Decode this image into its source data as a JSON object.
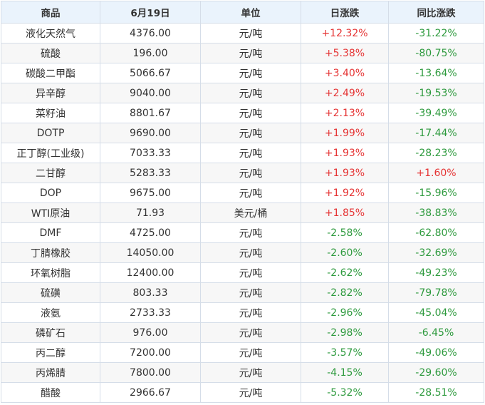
{
  "colors": {
    "up": "#e53333",
    "down": "#2e9a3e",
    "header_bg": "#eaf3fc",
    "border": "#d5dde8"
  },
  "headers": [
    "商品",
    "6月19日",
    "单位",
    "日涨跌",
    "同比涨跌"
  ],
  "rows": [
    [
      "液化天然气",
      "4376.00",
      "元/吨",
      "+12.32%",
      "-31.22%"
    ],
    [
      "硫酸",
      "196.00",
      "元/吨",
      "+5.38%",
      "-80.75%"
    ],
    [
      "碳酸二甲酯",
      "5066.67",
      "元/吨",
      "+3.40%",
      "-13.64%"
    ],
    [
      "异辛醇",
      "9040.00",
      "元/吨",
      "+2.49%",
      "-19.53%"
    ],
    [
      "菜籽油",
      "8801.67",
      "元/吨",
      "+2.13%",
      "-39.49%"
    ],
    [
      "DOTP",
      "9690.00",
      "元/吨",
      "+1.99%",
      "-17.44%"
    ],
    [
      "正丁醇(工业级)",
      "7033.33",
      "元/吨",
      "+1.93%",
      "-28.23%"
    ],
    [
      "二甘醇",
      "5283.33",
      "元/吨",
      "+1.93%",
      "+1.60%"
    ],
    [
      "DOP",
      "9675.00",
      "元/吨",
      "+1.92%",
      "-15.96%"
    ],
    [
      "WTI原油",
      "71.93",
      "美元/桶",
      "+1.85%",
      "-38.83%"
    ],
    [
      "DMF",
      "4725.00",
      "元/吨",
      "-2.58%",
      "-62.80%"
    ],
    [
      "丁腈橡胶",
      "14050.00",
      "元/吨",
      "-2.60%",
      "-32.69%"
    ],
    [
      "环氧树脂",
      "12400.00",
      "元/吨",
      "-2.62%",
      "-49.23%"
    ],
    [
      "硫磺",
      "803.33",
      "元/吨",
      "-2.82%",
      "-79.78%"
    ],
    [
      "液氨",
      "2733.33",
      "元/吨",
      "-2.96%",
      "-45.04%"
    ],
    [
      "磷矿石",
      "976.00",
      "元/吨",
      "-2.98%",
      "-6.45%"
    ],
    [
      "丙二醇",
      "7200.00",
      "元/吨",
      "-3.57%",
      "-49.06%"
    ],
    [
      "丙烯腈",
      "7800.00",
      "元/吨",
      "-4.15%",
      "-29.60%"
    ],
    [
      "醋酸",
      "2966.67",
      "元/吨",
      "-5.32%",
      "-28.51%"
    ]
  ]
}
